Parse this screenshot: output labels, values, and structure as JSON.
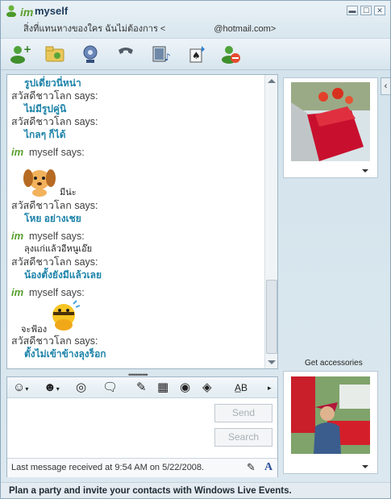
{
  "window": {
    "title_logo": "im",
    "title": "myself",
    "subtitle_prefix": "สิ่งที่แทนหางของใคร ฉันไม่ต้องการ <",
    "subtitle_suffix": "@hotmail.com>",
    "controls": [
      "▬",
      "☐",
      "✕"
    ]
  },
  "toolbar": {
    "icons": [
      "invite-contact-icon",
      "share-folder-icon",
      "webcam-icon",
      "call-icon",
      "video-icon",
      "games-icon",
      "block-icon"
    ]
  },
  "conversation": {
    "lines": [
      {
        "type": "msg",
        "text": "รูปเดี่ยวนี่หน่า"
      },
      {
        "type": "name",
        "text": "สวัสดีชาวโลก says:"
      },
      {
        "type": "msg",
        "text": "ไม่มีรูปคู่นิ"
      },
      {
        "type": "name",
        "text": "สวัสดีชาวโลก says:"
      },
      {
        "type": "msg",
        "text": "ไกลๆ ก็ได้"
      },
      {
        "type": "im",
        "badge": "im",
        "text": "myself says:"
      },
      {
        "type": "emoticon",
        "icon": "puppy-emoticon",
        "caption": "มีน่ะ"
      },
      {
        "type": "name",
        "text": "สวัสดีชาวโลก says:"
      },
      {
        "type": "msg",
        "text": "โหย อย่างเชย"
      },
      {
        "type": "im",
        "badge": "im",
        "text": "myself says:"
      },
      {
        "type": "dark",
        "text": "ลุงแก่แล้วอีหนูเอ๊ย"
      },
      {
        "type": "name",
        "text": "สวัสดีชาวโลก says:"
      },
      {
        "type": "msg",
        "text": "น้องตั้งยังมีแล้วเลย"
      },
      {
        "type": "im",
        "badge": "im",
        "text": "myself says:"
      },
      {
        "type": "emoticon",
        "icon": "bee-emoticon",
        "caption": "จะฟ้อง"
      },
      {
        "type": "name",
        "text": "สวัสดีชาวโลก says:"
      },
      {
        "type": "msg",
        "text": "ตั้งไม่เข้าข้างลุงร็อก"
      }
    ]
  },
  "input": {
    "send_label": "Send",
    "search_label": "Search",
    "status_text": "Last message received at 9:54 AM on 5/22/2008.",
    "font_label": "A"
  },
  "right_panel": {
    "accessories_label": "Get accessories"
  },
  "footer": {
    "text": "Plan a party and invite your contacts with Windows Live Events."
  },
  "colors": {
    "message_blue": "#1d83a9",
    "im_green": "#5aa030"
  }
}
